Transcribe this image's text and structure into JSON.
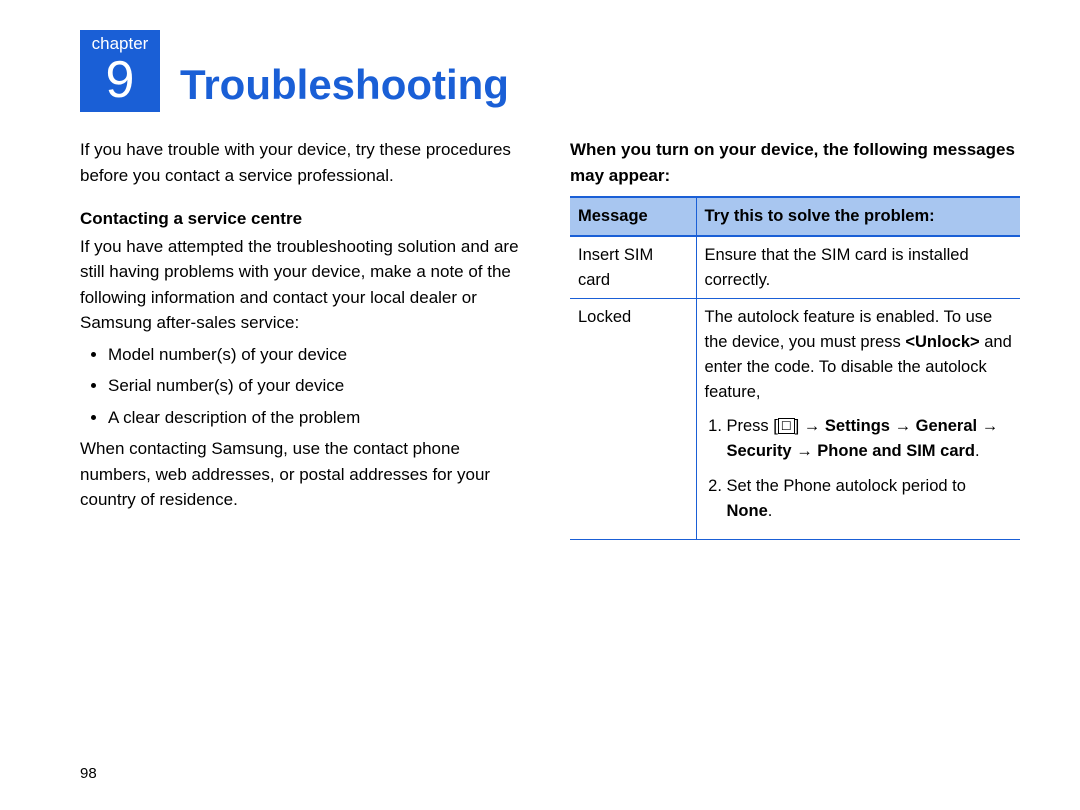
{
  "chapter": {
    "label": "chapter",
    "number": "9",
    "title": "Troubleshooting"
  },
  "left": {
    "intro": "If you have trouble with your device, try these procedures before you contact a service professional.",
    "section_heading": "Contacting a service centre",
    "para1": "If you have attempted the troubleshooting solution and are still having problems with your device, make a note of the following information and contact your local dealer or Samsung after-sales service:",
    "bullets": [
      "Model number(s) of your device",
      "Serial number(s) of your device",
      "A clear description of the problem"
    ],
    "para2": "When contacting Samsung, use the contact phone numbers, web addresses, or postal addresses for your country of residence."
  },
  "right": {
    "heading": "When you turn on your device, the following messages may appear:",
    "table": {
      "headers": {
        "message": "Message",
        "solution": "Try this to solve the problem:"
      },
      "row1": {
        "message": "Insert SIM card",
        "solution": "Ensure that the SIM card is installed correctly."
      },
      "row2": {
        "message": "Locked",
        "para_a": "The autolock feature is enabled. To use the device, you must press ",
        "unlock": "<Unlock>",
        "para_b": " and enter the code. To disable the autolock feature,",
        "step1_a": "Press [",
        "step1_b": "] → ",
        "step1_bold1": "Settings",
        "step1_arrow1": " → ",
        "step1_bold2": "General",
        "step1_arrow2": " → ",
        "step1_bold3": "Security",
        "step1_arrow3": " → ",
        "step1_bold4": "Phone and SIM card",
        "step1_dot": ".",
        "step2_a": "Set the Phone autolock period to ",
        "step2_bold": "None",
        "step2_dot": "."
      }
    }
  },
  "page_number": "98"
}
